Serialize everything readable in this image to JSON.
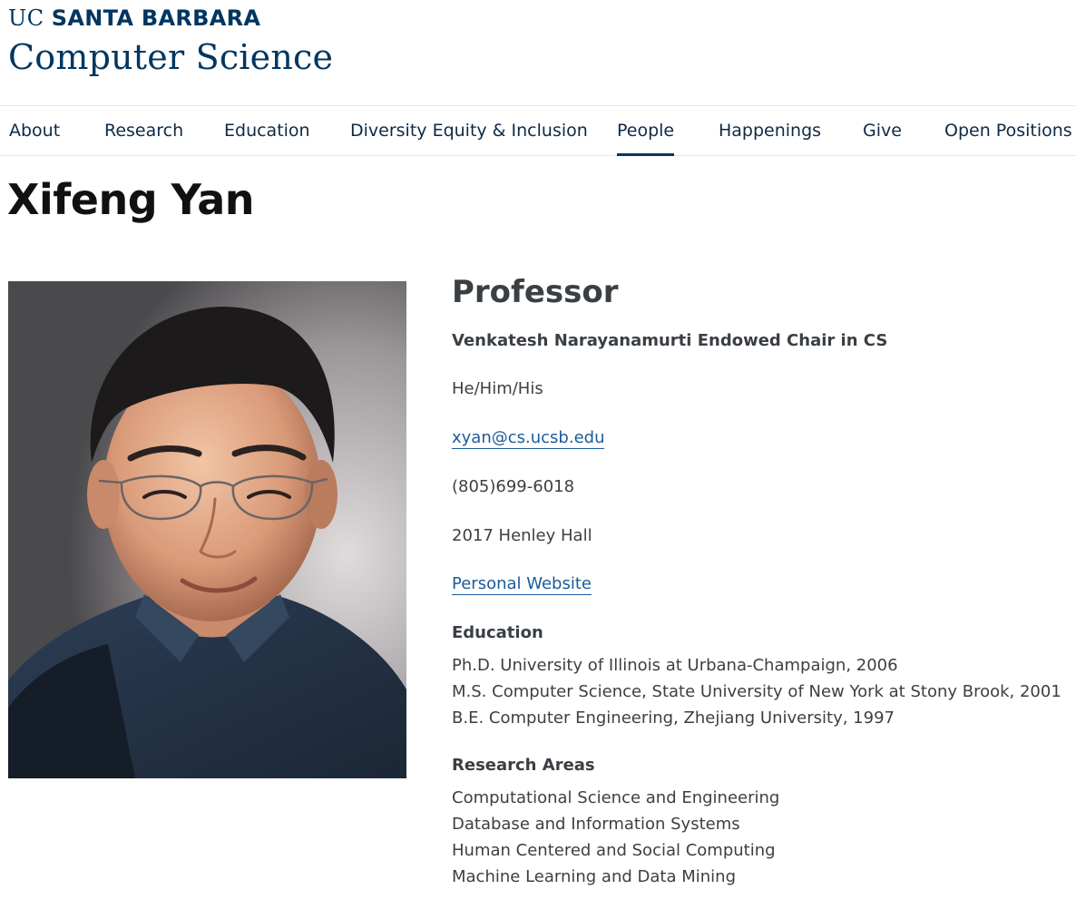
{
  "brand": {
    "uc": "UC",
    "santa_barbara": "SANTA BARBARA",
    "department": "Computer Science"
  },
  "nav": {
    "items": [
      {
        "label": "About"
      },
      {
        "label": "Research"
      },
      {
        "label": "Education"
      },
      {
        "label": "Diversity Equity & Inclusion"
      },
      {
        "label": "People",
        "active": true
      },
      {
        "label": "Happenings"
      },
      {
        "label": "Give"
      },
      {
        "label": "Open Positions"
      }
    ]
  },
  "profile": {
    "name": "Xifeng Yan",
    "title": "Professor",
    "chair": "Venkatesh Narayanamurti Endowed Chair in CS",
    "pronouns": "He/Him/His",
    "email": "xyan@cs.ucsb.edu",
    "phone": "(805)699-6018",
    "office": "2017 Henley Hall",
    "website_label": "Personal Website"
  },
  "education": {
    "heading": "Education",
    "items": [
      "Ph.D. University of Illinois at Urbana-Champaign, 2006",
      "M.S. Computer Science, State University of New York at Stony Brook, 2001",
      "B.E. Computer Engineering, Zhejiang University, 1997"
    ]
  },
  "research": {
    "heading": "Research Areas",
    "items": [
      "Computational Science and Engineering",
      "Database and Information Systems",
      "Human Centered and Social Computing",
      "Machine Learning and Data Mining"
    ]
  },
  "colors": {
    "brand_navy": "#003660",
    "link_blue": "#1a5b9a",
    "text": "#3c4043"
  }
}
